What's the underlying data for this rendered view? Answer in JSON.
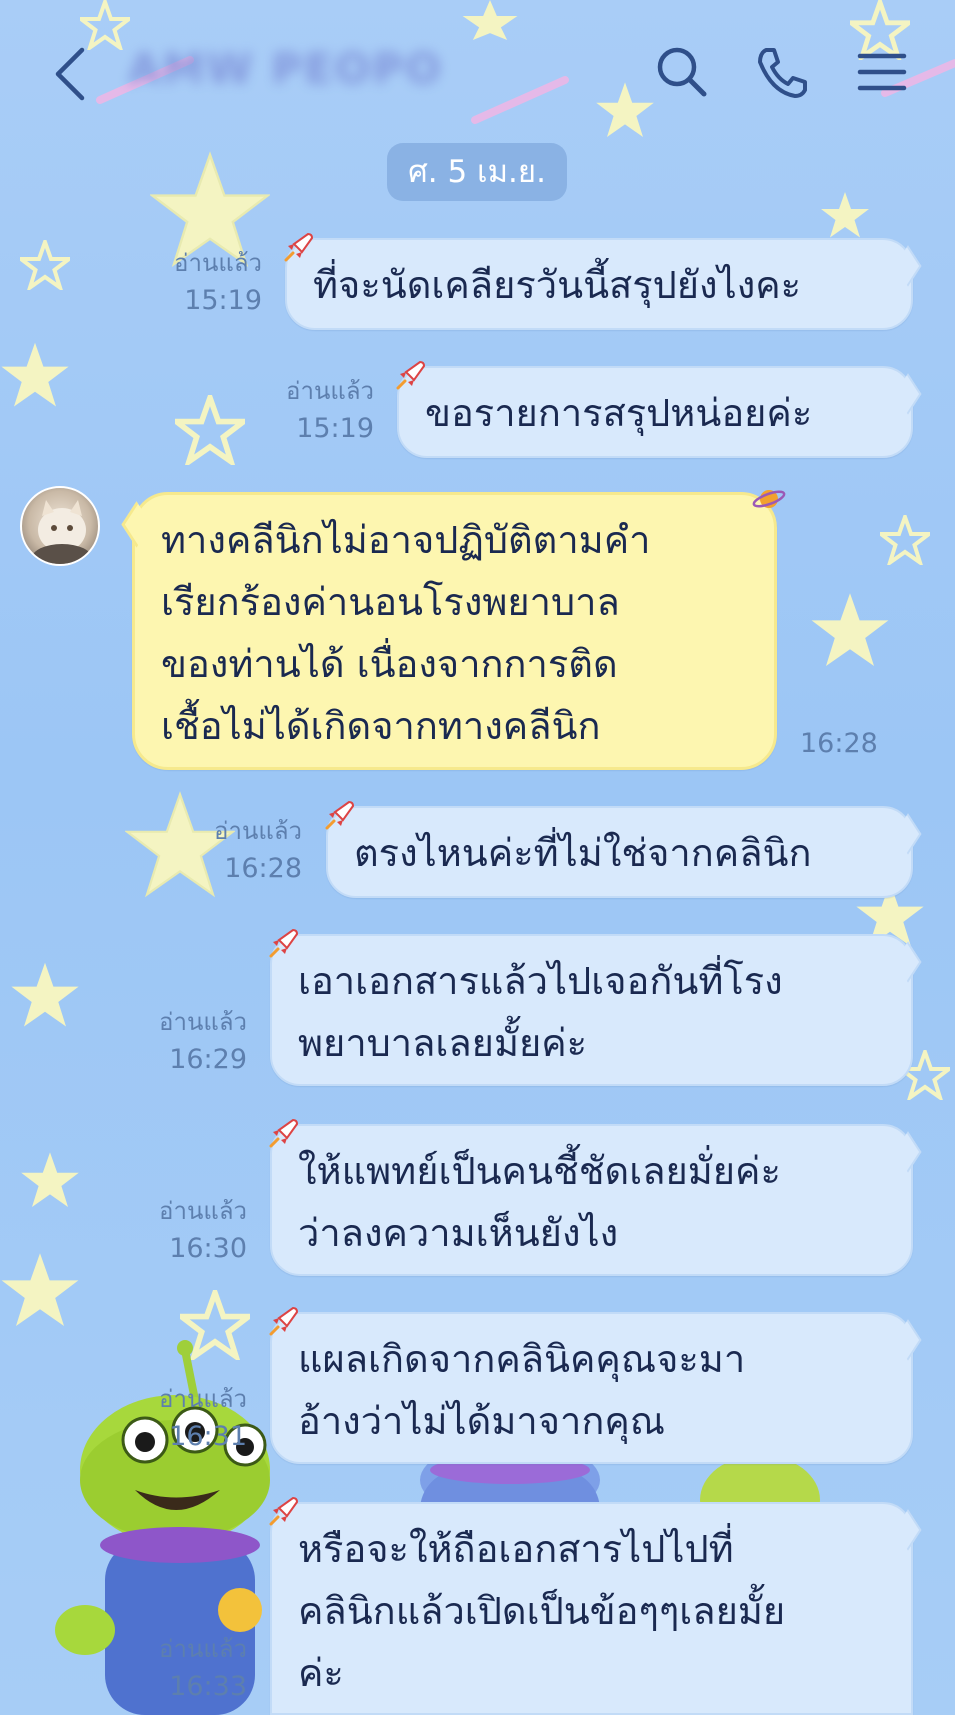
{
  "header": {
    "title": "AMW PEOPO",
    "back_icon": "chevron-left-icon",
    "search_icon": "search-icon",
    "call_icon": "phone-icon",
    "menu_icon": "menu-icon"
  },
  "date_separator": "ศ. 5 เม.ย.",
  "colors": {
    "background": "#a9cdf7",
    "outgoing_bubble": "#d8e9fc",
    "incoming_bubble": "#fdf6b0",
    "meta_text": "#5d7fae",
    "message_text": "#1a2950"
  },
  "messages": [
    {
      "direction": "out",
      "lines": [
        "ที่จะนัดเคลียรวันนี้สรุปยังไงคะ"
      ],
      "read": "อ่านแล้ว",
      "time": "15:19"
    },
    {
      "direction": "out",
      "lines": [
        "ขอรายการสรุปหน่อยค่ะ"
      ],
      "read": "อ่านแล้ว",
      "time": "15:19"
    },
    {
      "direction": "in",
      "lines": [
        "ทางคลีนิกไม่อาจปฏิบัติตามคำ",
        "เรียกร้องค่านอนโรงพยาบาล",
        "ของท่านได้ เนื่องจากการติด",
        "เชื้อไม่ได้เกิดจากทางคลีนิก"
      ],
      "time": "16:28"
    },
    {
      "direction": "out",
      "lines": [
        "ตรงไหนค่ะที่ไม่ใช่จากคลินิก"
      ],
      "read": "อ่านแล้ว",
      "time": "16:28"
    },
    {
      "direction": "out",
      "lines": [
        "เอาเอกสารแล้วไปเจอกันที่โรง",
        "พยาบาลเลยมั้ยค่ะ"
      ],
      "read": "อ่านแล้ว",
      "time": "16:29"
    },
    {
      "direction": "out",
      "lines": [
        "ให้แพทย์เป็นคนชี้ชัดเลยมั่ยค่ะ",
        "ว่าลงความเห็นยังไง"
      ],
      "read": "อ่านแล้ว",
      "time": "16:30"
    },
    {
      "direction": "out",
      "lines": [
        "แผลเกิดจากคลินิคคุณจะมา",
        "อ้างว่าไม่ได้มาจากคุณ"
      ],
      "read": "อ่านแล้ว",
      "time": "16:31"
    },
    {
      "direction": "out",
      "lines": [
        "หรือจะให้ถือเอกสารไปไปที่",
        "คลินิกแล้วเปิดเป็นข้อๆๆเลยมั้ย",
        "ค่ะ"
      ],
      "read": "อ่านแล้ว",
      "time": "16:33"
    }
  ]
}
